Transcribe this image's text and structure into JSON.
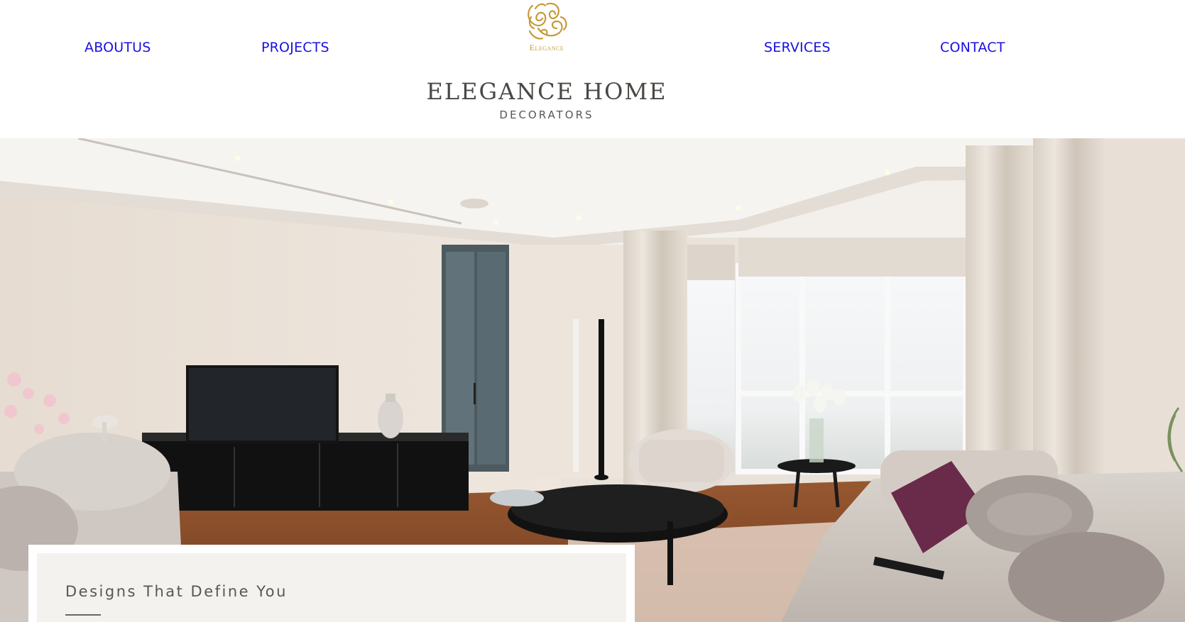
{
  "nav": {
    "left": [
      {
        "label": "ABOUTUS"
      },
      {
        "label": "PROJECTS"
      }
    ],
    "right": [
      {
        "label": "SERVICES"
      },
      {
        "label": "CONTACT"
      }
    ],
    "link_color": "#1a10e0"
  },
  "logo": {
    "icon": "ornamental-monogram-icon",
    "wordmark": "Elegance",
    "color": "#c69a3a"
  },
  "brand": {
    "title": "ELEGANCE HOME",
    "subtitle": "DECORATORS"
  },
  "hero": {
    "image": "living-room-interior-photo"
  },
  "card": {
    "heading": "Designs That Define You"
  }
}
